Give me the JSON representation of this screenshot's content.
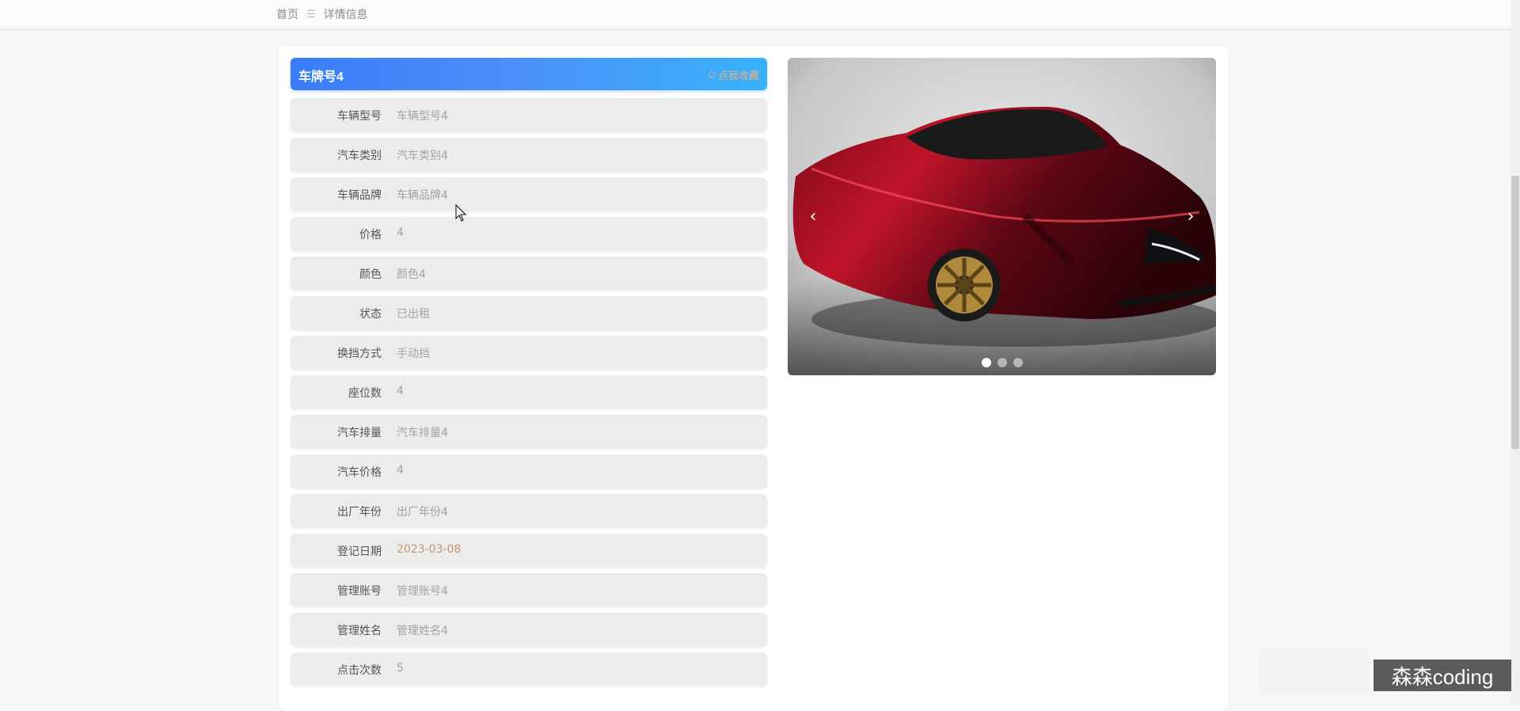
{
  "breadcrumb": {
    "home": "首页",
    "separator": "☰",
    "current": "详情信息"
  },
  "title": {
    "text": "车牌号4",
    "favorite_label": "点我收藏",
    "favorite_icon": "star-outline-icon",
    "gradient_start": "#3a7cf6",
    "gradient_end": "#38b2fb"
  },
  "fields": [
    {
      "label": "车辆型号",
      "value": "车辆型号4"
    },
    {
      "label": "汽车类别",
      "value": "汽车类别4"
    },
    {
      "label": "车辆品牌",
      "value": "车辆品牌4"
    },
    {
      "label": "价格",
      "value": "4"
    },
    {
      "label": "颜色",
      "value": "颜色4"
    },
    {
      "label": "状态",
      "value": "已出租"
    },
    {
      "label": "换挡方式",
      "value": "手动挡"
    },
    {
      "label": "座位数",
      "value": "4"
    },
    {
      "label": "汽车排量",
      "value": "汽车排量4"
    },
    {
      "label": "汽车价格",
      "value": "4"
    },
    {
      "label": "出厂年份",
      "value": "出厂年份4"
    },
    {
      "label": "登记日期",
      "value": "2023-03-08"
    },
    {
      "label": "管理账号",
      "value": "管理账号4"
    },
    {
      "label": "管理姓名",
      "value": "管理姓名4"
    },
    {
      "label": "点击次数",
      "value": "5"
    }
  ],
  "carousel": {
    "prev_icon": "chevron-left-icon",
    "next_icon": "chevron-right-icon",
    "slide_count": 3,
    "active_index": 0
  },
  "watermark": "森森coding"
}
